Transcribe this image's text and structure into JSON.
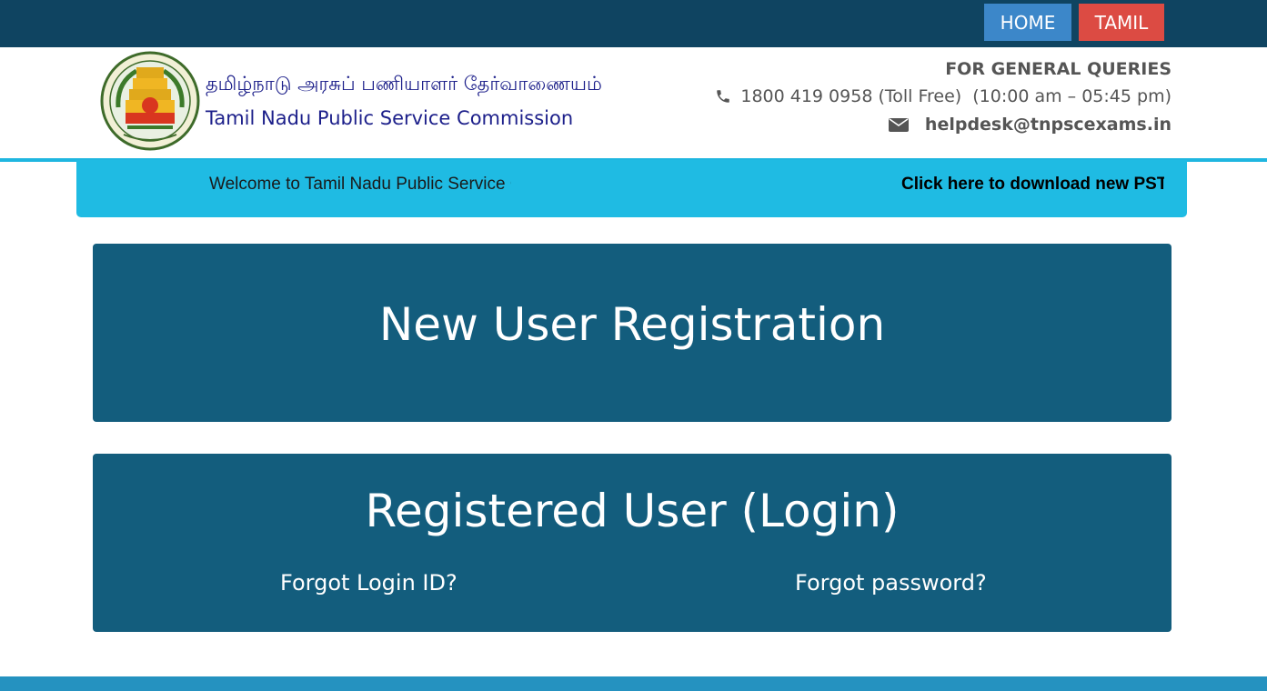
{
  "topbar": {
    "home_label": "HOME",
    "tamil_label": "TAMIL"
  },
  "header": {
    "logo_icon": "tamil-nadu-emblem",
    "title_tamil": "தமிழ்நாடு அரசுப் பணியாளர் தேர்வாணையம்",
    "title_english": "Tamil Nadu Public Service Commission",
    "queries_title": "FOR GENERAL QUERIES",
    "phone_icon": "phone-icon",
    "phone_text": "1800 419 0958 (Toll Free)  (10:00 am – 05:45 pm)",
    "email_icon": "envelope-icon",
    "email_text": "helpdesk@tnpscexams.in"
  },
  "marquee": {
    "welcome_text": "Welcome to Tamil Nadu Public Service Commission",
    "download_link": "Click here to download new PSTM certificate format"
  },
  "cards": {
    "new_user_label": "New User Registration",
    "login_label": "Registered User (Login)",
    "forgot_id_label": "Forgot Login ID?",
    "forgot_password_label": "Forgot password?"
  },
  "colors": {
    "topbar": "#0f4461",
    "home_button": "#3c87c9",
    "tamil_button": "#dc4b43",
    "marquee": "#1fbbe3",
    "card": "#135d7d",
    "header_text": "#1c1f8a"
  }
}
